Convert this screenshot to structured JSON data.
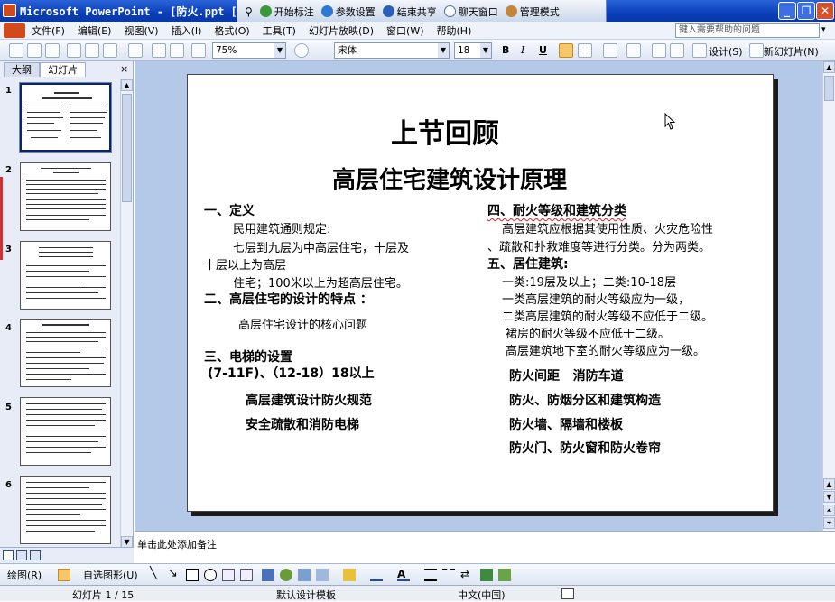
{
  "window": {
    "title": "Microsoft PowerPoint - [防火.ppt ["
  },
  "collab_bar": {
    "items": [
      "开始标注",
      "参数设置",
      "结束共享",
      "聊天窗口",
      "管理模式"
    ]
  },
  "menubar": {
    "items": [
      "文件(F)",
      "编辑(E)",
      "视图(V)",
      "插入(I)",
      "格式(O)",
      "工具(T)",
      "幻灯片放映(D)",
      "窗口(W)",
      "帮助(H)"
    ],
    "help_placeholder": "键入需要帮助的问题"
  },
  "toolbar": {
    "zoom": "75%",
    "font": "宋体",
    "font_size": "18",
    "bold": "B",
    "italic": "I",
    "underline": "U",
    "design_label": "设计(S)",
    "new_slide_label": "新幻灯片(N)"
  },
  "left_pane": {
    "tabs": [
      "大纲",
      "幻灯片"
    ],
    "close": "×",
    "thumbnails": [
      "1",
      "2",
      "3",
      "4",
      "5",
      "6"
    ]
  },
  "slide": {
    "title": "上节回顾",
    "subtitle": "高层住宅建筑设计原理",
    "left": {
      "h1": "一、定义",
      "l1": "民用建筑通则规定:",
      "l2": "七层到九层为中高层住宅，十层及",
      "l3": "十层以上为高层",
      "l4": "住宅；100米以上为超高层住宅。",
      "h2": "二、高层住宅的设计的特点 ：",
      "l5": "高层住宅设计的核心问题",
      "h3": "三、电梯的设置",
      "l6": "(7-11F)、（12-18）18以上",
      "l7": "高层建筑设计防火规范",
      "l8": "安全疏散和消防电梯"
    },
    "right": {
      "h4": "四、耐火等级和建筑分类",
      "r1": "高层建筑应根据其使用性质、火灾危险性",
      "r2": "、疏散和扑救难度等进行分类。分为两类。",
      "h5": "五、居住建筑:",
      "r3": "一类:19层及以上；二类:10-18层",
      "r4": "一类高层建筑的耐火等级应为一级，",
      "r5": "二类高层建筑的耐火等级不应低于二级。",
      "r6": "裙房的耐火等级不应低于二级。",
      "r7": "高层建筑地下室的耐火等级应为一级。",
      "r8": "防火间距   消防车道",
      "r9": "防火、防烟分区和建筑构造",
      "r10": "防火墙、隔墙和楼板",
      "r11": "防火门、防火窗和防火卷帘"
    }
  },
  "notes": {
    "placeholder": "单击此处添加备注"
  },
  "drawbar": {
    "draw_label": "绘图(R)",
    "autoshape_label": "自选图形(U)"
  },
  "status": {
    "slide_info": "幻灯片 1 / 15",
    "template": "默认设计模板",
    "language": "中文(中国)"
  },
  "colors": {
    "titlebar": "#0a3fb8",
    "workspace": "#b4c8e8",
    "spell_underline": "#e02020"
  }
}
